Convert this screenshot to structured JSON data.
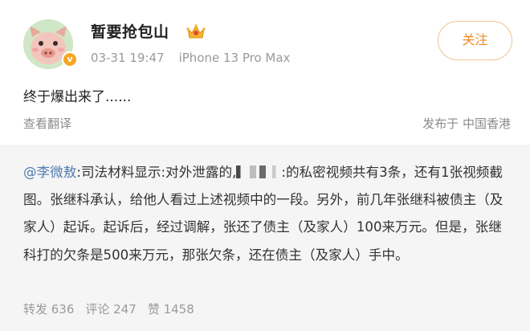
{
  "post": {
    "username": "暂要抢包山",
    "date": "03-31 19:47",
    "device": "iPhone 13 Pro Max",
    "follow_label": "关注",
    "content": "终于爆出来了......",
    "translate_label": "查看翻译",
    "location": "发布于 中国香港",
    "avatar_badge": "v",
    "icons": [
      "avatar",
      "verified-badge-icon",
      "crown-icon"
    ]
  },
  "retweet": {
    "mention": "@李微敖",
    "text_before_redaction": ":司法材料显示:对外泄露的,",
    "text_after_redaction": ":的私密视频共有3条，还有1张视频截图。张继科承认，给他人看过上述视频中的一段。另外，前几年张继科被债主（及家人）起诉。起诉后，经过调解，张还了债主（及家人）100来万元。但是，张继科打的欠条是500来万元，那张欠条，还在债主（及家人）手中。",
    "stats": {
      "reposts": "转发 636",
      "comments": "评论 247",
      "likes": "赞 1458"
    }
  },
  "colors": {
    "accent_orange": "#f08a24",
    "mention_blue": "#507daf",
    "retweet_bg": "#f5f5f5"
  }
}
